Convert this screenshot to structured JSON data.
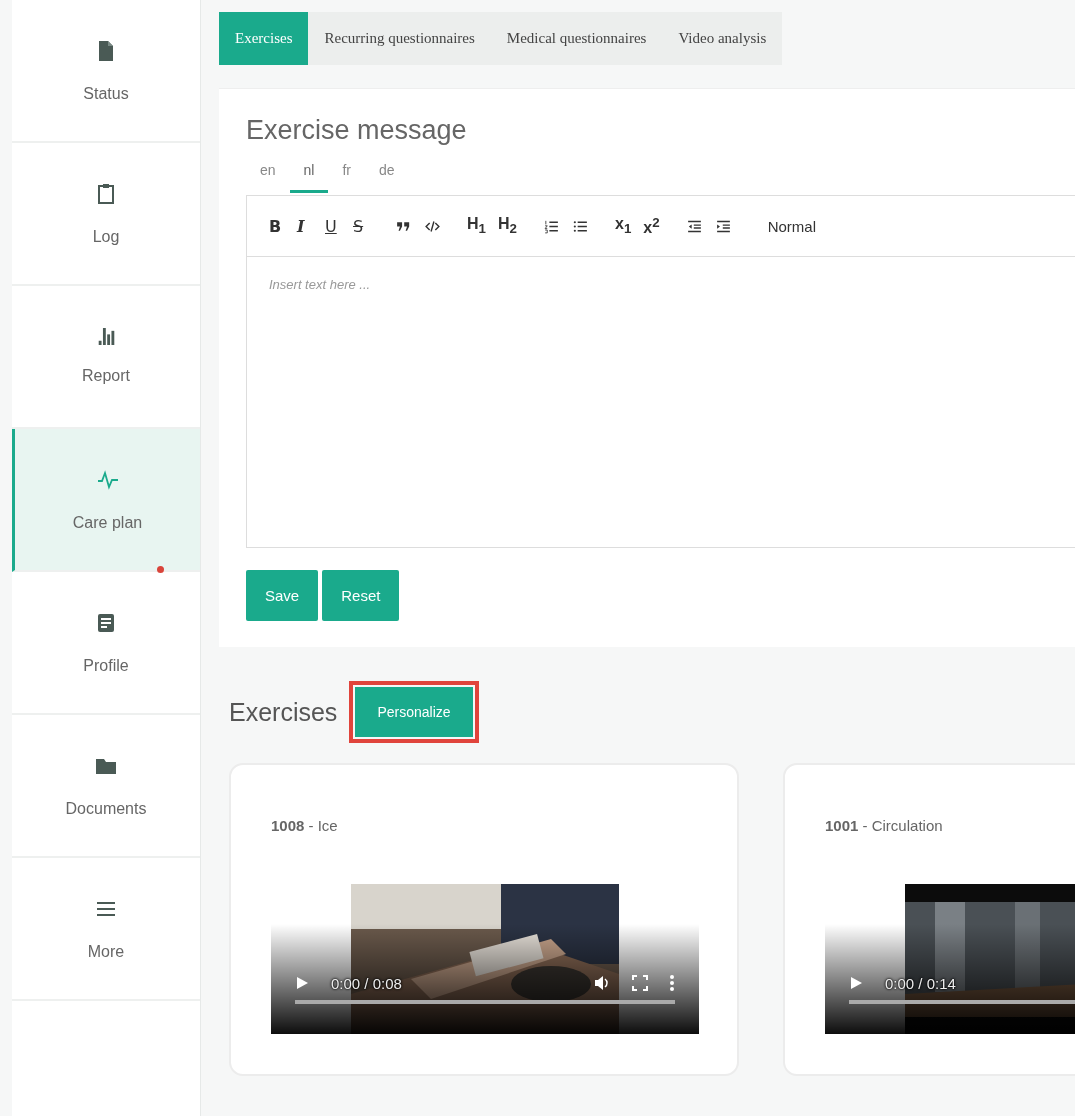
{
  "sidebar": {
    "items": [
      {
        "label": "Status",
        "kind": "file",
        "selected": false,
        "notification": false
      },
      {
        "label": "Log",
        "kind": "clipboard",
        "selected": false,
        "notification": false
      },
      {
        "label": "Report",
        "kind": "chart",
        "selected": false,
        "notification": false
      },
      {
        "label": "Care plan",
        "kind": "pulse",
        "selected": true,
        "notification": true
      },
      {
        "label": "Profile",
        "kind": "note",
        "selected": false,
        "notification": false
      },
      {
        "label": "Documents",
        "kind": "folder",
        "selected": false,
        "notification": false
      },
      {
        "label": "More",
        "kind": "menu",
        "selected": false,
        "notification": false
      }
    ]
  },
  "tabs": [
    {
      "label": "Exercises",
      "selected": true
    },
    {
      "label": "Recurring questionnaires",
      "selected": false
    },
    {
      "label": "Medical questionnaires",
      "selected": false
    },
    {
      "label": "Video analysis",
      "selected": false
    }
  ],
  "message_card": {
    "title": "Exercise message",
    "languages": [
      {
        "label": "en",
        "selected": false
      },
      {
        "label": "nl",
        "selected": true
      },
      {
        "label": "fr",
        "selected": false
      },
      {
        "label": "de",
        "selected": false
      }
    ],
    "toolbar": [
      [
        {
          "kind": "bold",
          "label": "B"
        },
        {
          "kind": "italic",
          "label": "I"
        },
        {
          "kind": "underline",
          "label": "U"
        },
        {
          "kind": "strike",
          "label": "S"
        }
      ],
      [
        {
          "kind": "quote"
        },
        {
          "kind": "code"
        }
      ],
      [
        {
          "kind": "header",
          "label": "H$_{1}$"
        },
        {
          "kind": "header",
          "label": "H$_{2}$"
        }
      ],
      [
        {
          "kind": "ordered-list"
        },
        {
          "kind": "bullet-list"
        }
      ],
      [
        {
          "kind": "script",
          "label": "x$_{1}$"
        },
        {
          "kind": "script",
          "label": "x$^{2}$"
        }
      ],
      [
        {
          "kind": "outdent"
        },
        {
          "kind": "indent"
        }
      ],
      [
        {
          "kind": "select",
          "label": "Normal"
        }
      ]
    ],
    "placeholder": "Insert text here ...",
    "buttons": [
      "Save",
      "Reset"
    ]
  },
  "exercises": {
    "title": "Exercises",
    "personalize_button": {
      "label": "Personalize",
      "highlighted": true
    },
    "cards": [
      {
        "title": "**1008** - Ice",
        "time": "0:00 / 0:08",
        "kind": "picture"
      },
      {
        "title": "**1001** - Circulation",
        "time": "0:00 / 0:14",
        "kind": "picture"
      }
    ]
  }
}
